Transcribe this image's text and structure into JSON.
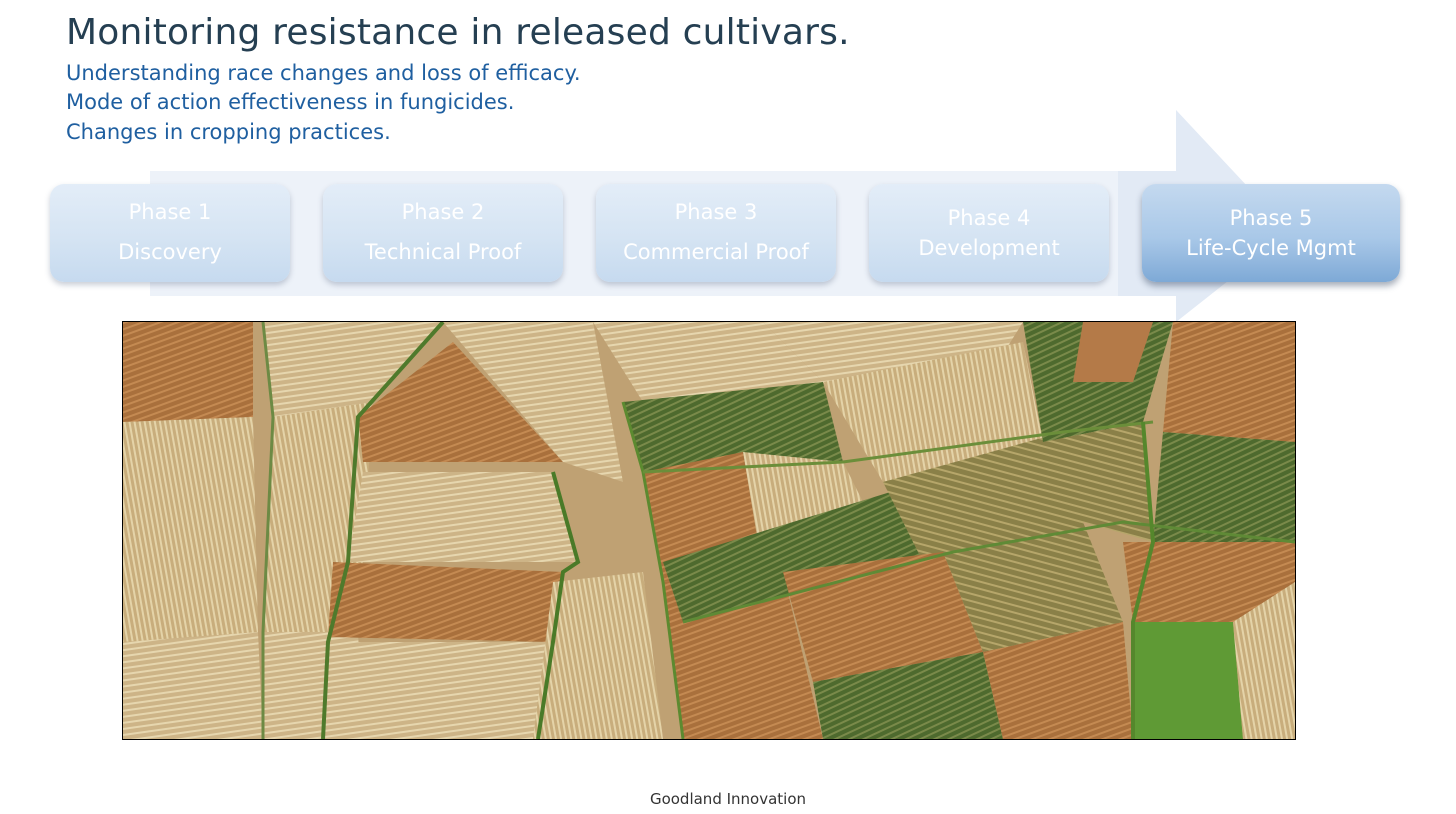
{
  "slide": {
    "title": "Monitoring resistance in released cultivars.",
    "bullets": [
      "Understanding race changes and loss of efficacy.",
      "Mode of action effectiveness in fungicides.",
      "Changes in cropping practices."
    ],
    "footer": "Goodland Innovation"
  },
  "phases": [
    {
      "label": "Phase 1",
      "name": "Discovery",
      "active": false
    },
    {
      "label": "Phase 2",
      "name": "Technical Proof",
      "active": false
    },
    {
      "label": "Phase 3",
      "name": "Commercial Proof",
      "active": false
    },
    {
      "label": "Phase 4",
      "name": "Development",
      "active": false
    },
    {
      "label": "Phase 5",
      "name": "Life-Cycle Mgmt",
      "active": true
    }
  ],
  "colors": {
    "title": "#253f52",
    "bullets": "#1f5fa0",
    "arrow": "#e4edf7",
    "phase_active": "#9fc2e6"
  },
  "image": {
    "subject": "aerial view of patchwork crop fields"
  }
}
